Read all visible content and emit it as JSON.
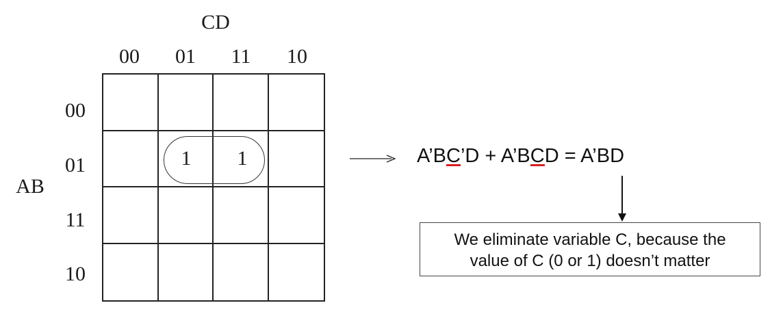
{
  "kmap": {
    "col_var": "CD",
    "row_var": "AB",
    "col_headers": [
      "00",
      "01",
      "11",
      "10"
    ],
    "row_headers": [
      "00",
      "01",
      "11",
      "10"
    ],
    "cells": [
      [
        "",
        "",
        "",
        ""
      ],
      [
        "",
        "1",
        "1",
        ""
      ],
      [
        "",
        "",
        "",
        ""
      ],
      [
        "",
        "",
        "",
        ""
      ]
    ],
    "group": {
      "row": "01",
      "cols": [
        "01",
        "11"
      ]
    }
  },
  "expression": {
    "part1": "A’B",
    "part2_underlined": "C",
    "part3": "’D + A’B",
    "part4_underlined": "C",
    "part5": "D = A’BD"
  },
  "note": {
    "line1": "We eliminate variable C, because the",
    "line2": "value of C (0 or 1) doesn’t matter"
  },
  "colors": {
    "line": "#222222",
    "underline_mark": "#d62020"
  }
}
